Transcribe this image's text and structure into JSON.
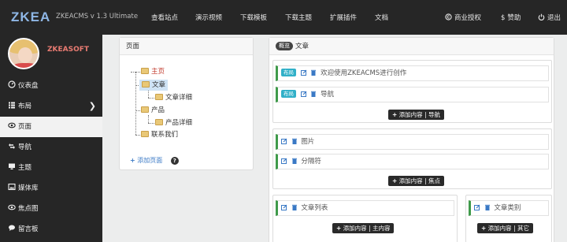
{
  "topbar": {
    "brand": "ZKEA",
    "version": "ZKEACMS v 1.3 Ultimate",
    "nav": [
      "查看站点",
      "演示视频",
      "下载模板",
      "下载主题",
      "扩展插件",
      "文档"
    ],
    "right": [
      "商业授权",
      "赞助",
      "退出"
    ]
  },
  "sidebar": {
    "username": "ZKEASOFT",
    "items": [
      {
        "label": "仪表盘",
        "icon": "dashboard-icon"
      },
      {
        "label": "布局",
        "icon": "layout-icon"
      },
      {
        "label": "页面",
        "icon": "eye-icon"
      },
      {
        "label": "导航",
        "icon": "navigation-icon"
      },
      {
        "label": "主题",
        "icon": "theme-icon"
      },
      {
        "label": "媒体库",
        "icon": "media-icon"
      },
      {
        "label": "焦点图",
        "icon": "carousel-icon"
      },
      {
        "label": "留言板",
        "icon": "comment-icon"
      }
    ],
    "active_index": 2
  },
  "pages_panel": {
    "title": "页面",
    "tree": [
      "主页",
      "文章",
      "文章详细",
      "产品",
      "产品详细",
      "联系我们"
    ],
    "add_page": "添加页面",
    "help": "?"
  },
  "layout_panel": {
    "preview_badge": "概览",
    "title": "文章",
    "zones": [
      {
        "widgets": [
          {
            "tag": "布局",
            "text": "欢迎使用ZKEACMS进行创作"
          },
          {
            "tag": "布局",
            "text": "导航"
          }
        ],
        "add_label": "添加内容 | 导航"
      },
      {
        "widgets": [
          {
            "tag": "",
            "text": "图片"
          },
          {
            "tag": "",
            "text": "分隔符"
          }
        ],
        "add_label": "添加内容 | 焦点"
      },
      {
        "widgets": [
          {
            "tag": "",
            "text": "文章列表"
          }
        ],
        "add_label": "添加内容 | 主内容"
      },
      {
        "widgets": [
          {
            "tag": "",
            "text": "文章类别"
          }
        ],
        "add_label": "添加内容 | 其它"
      }
    ]
  },
  "colors": {
    "topbar": "#262626",
    "sidebar": "#262626",
    "accent_green": "#3f9a4a",
    "home_red": "#c0392b",
    "tag_blue": "#31b0c8"
  }
}
